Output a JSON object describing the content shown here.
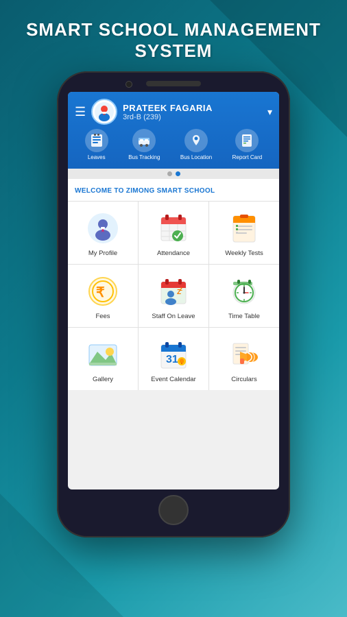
{
  "page": {
    "title_line1": "SMART SCHOOL MANAGEMENT",
    "title_line2": "SYSTEM",
    "background_color": "#0a7a8c"
  },
  "header": {
    "user_name": "PRATEEK FAGARIA",
    "user_class": "3rd-B (239)",
    "dropdown_icon": "▾"
  },
  "nav_items": [
    {
      "label": "Leaves",
      "icon": "📋"
    },
    {
      "label": "Bus Tracking",
      "icon": "🚌"
    },
    {
      "label": "Bus Location",
      "icon": "📍"
    },
    {
      "label": "Report Card",
      "icon": "📄"
    }
  ],
  "dots": [
    {
      "active": false
    },
    {
      "active": true
    }
  ],
  "welcome_text": "WELCOME TO ZIMONG SMART SCHOOL",
  "menu_items": [
    {
      "label": "My Profile",
      "icon_type": "profile"
    },
    {
      "label": "Attendance",
      "icon_type": "attendance"
    },
    {
      "label": "Weekly Tests",
      "icon_type": "weekly_tests"
    },
    {
      "label": "Fees",
      "icon_type": "fees"
    },
    {
      "label": "Staff On Leave",
      "icon_type": "staff_on_leave"
    },
    {
      "label": "Time Table",
      "icon_type": "time_table"
    },
    {
      "label": "Gallery",
      "icon_type": "gallery"
    },
    {
      "label": "Event Calendar",
      "icon_type": "event_calendar"
    },
    {
      "label": "Circulars",
      "icon_type": "circulars"
    }
  ]
}
